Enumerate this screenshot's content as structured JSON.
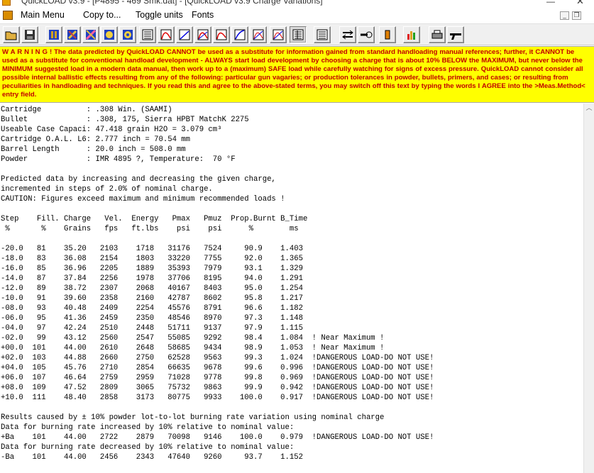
{
  "window": {
    "title": "QuickLOAD v3.9 - [P4895 - 469 Smk.dat] - [QuickLOAD v3.9 Charge Variations]",
    "min_glyph": "—",
    "close_glyph": "✕"
  },
  "menu": {
    "items": [
      "Main Menu",
      "Copy to...",
      "Toggle units",
      "Fonts"
    ],
    "mdi_min": "_",
    "mdi_restore": "❐"
  },
  "toolbar": {
    "button_icons": [
      "open-folder-icon",
      "save-disk-icon",
      "cartridge-data-icon",
      "bullet-data-icon",
      "powder-data-icon",
      "propellant-data-icon",
      "table-view-icon",
      "chart-pressure-icon",
      "chart-velocity-icon",
      "chart-energy-icon",
      "chart-burn-icon",
      "chart-combined-icon",
      "chart-multi-icon",
      "charge-table-icon",
      "charge-list-icon",
      "compare-icon",
      "barrel-icon",
      "warning-icon",
      "bar-chart-icon",
      "print-icon",
      "gun-icon"
    ]
  },
  "warning": {
    "text": "W A R N I N G ! The data predicted by QuickLOAD CANNOT be used as a substitute for information gained from standard handloading manual references; further, it CANNOT be used as a substitute for conventional handload development - ALWAYS start load development by choosing a charge that is about 10% BELOW the MAXIMUM, but never below the MINIMUM suggested load in a modern data manual, then work up to a (maximum) SAFE load while carefully watching for signs of excess pressure. QuickLOAD cannot consider all possible internal ballistic effects resulting from any of the following: particular gun vagaries; or production tolerances in powder, bullets, primers, and cases; or resulting from peculiarities in handloading and techniques. If you read this and agree to the above-stated terms, you may switch off this text by typing the words I AGREE into the >Meas.Method< entry field."
  },
  "output": {
    "lines": [
      "Cartridge          : .308 Win. (SAAMI)",
      "Bullet             : .308, 175, Sierra HPBT MatchK 2275",
      "Useable Case Capaci: 47.418 grain H2O = 3.079 cm³",
      "Cartridge O.A.L. L6: 2.777 inch = 70.54 mm",
      "Barrel Length      : 20.0 inch = 508.0 mm",
      "Powder             : IMR 4895 ?, Temperature:  70 °F",
      "",
      "Predicted data by increasing and decreasing the given charge,",
      "incremented in steps of 2.0% of nominal charge.",
      "CAUTION: Figures exceed maximum and minimum recommended loads !",
      "",
      "Step    Fill. Charge   Vel.  Energy   Pmax   Pmuz  Prop.Burnt B_Time",
      " %       %    Grains   fps   ft.lbs    psi    psi      %        ms",
      "",
      "-20.0   81    35.20   2103    1718   31176   7524     90.9    1.403",
      "-18.0   83    36.08   2154    1803   33220   7755     92.0    1.365",
      "-16.0   85    36.96   2205    1889   35393   7979     93.1    1.329",
      "-14.0   87    37.84   2256    1978   37706   8195     94.0    1.291",
      "-12.0   89    38.72   2307    2068   40167   8403     95.0    1.254",
      "-10.0   91    39.60   2358    2160   42787   8602     95.8    1.217",
      "-08.0   93    40.48   2409    2254   45576   8791     96.6    1.182",
      "-06.0   95    41.36   2459    2350   48546   8970     97.3    1.148",
      "-04.0   97    42.24   2510    2448   51711   9137     97.9    1.115",
      "-02.0   99    43.12   2560    2547   55085   9292     98.4    1.084  ! Near Maximum !",
      "+00.0  101    44.00   2610    2648   58685   9434     98.9    1.053  ! Near Maximum !",
      "+02.0  103    44.88   2660    2750   62528   9563     99.3    1.024  !DANGEROUS LOAD-DO NOT USE!",
      "+04.0  105    45.76   2710    2854   66635   9678     99.6    0.996  !DANGEROUS LOAD-DO NOT USE!",
      "+06.0  107    46.64   2759    2959   71028   9778     99.8    0.969  !DANGEROUS LOAD-DO NOT USE!",
      "+08.0  109    47.52   2809    3065   75732   9863     99.9    0.942  !DANGEROUS LOAD-DO NOT USE!",
      "+10.0  111    48.40   2858    3173   80775   9933    100.0    0.917  !DANGEROUS LOAD-DO NOT USE!",
      "",
      "Results caused by ± 10% powder lot-to-lot burning rate variation using nominal charge",
      "Data for burning rate increased by 10% relative to nominal value:",
      "+Ba    101    44.00   2722    2879   70098   9146    100.0    0.979  !DANGEROUS LOAD-DO NOT USE!",
      "Data for burning rate decreased by 10% relative to nominal value:",
      "-Ba    101    44.00   2456    2343   47640   9260     93.7    1.152"
    ]
  },
  "scrollbar": {
    "up_glyph": "︿"
  }
}
